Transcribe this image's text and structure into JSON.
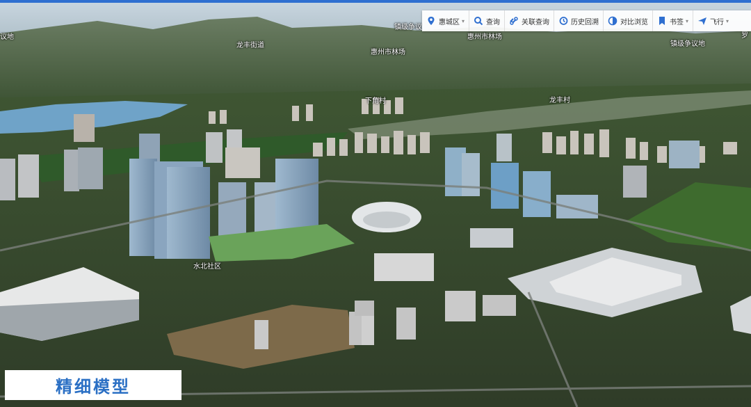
{
  "toolbar": {
    "items": [
      {
        "label": "惠城区",
        "icon": "location-pin-icon",
        "dropdown": true
      },
      {
        "label": "查询",
        "icon": "search-icon",
        "dropdown": false
      },
      {
        "label": "关联查询",
        "icon": "link-search-icon",
        "dropdown": false
      },
      {
        "label": "历史回溯",
        "icon": "history-icon",
        "dropdown": false
      },
      {
        "label": "对比浏览",
        "icon": "compare-icon",
        "dropdown": false
      },
      {
        "label": "书签",
        "icon": "bookmark-icon",
        "dropdown": true
      },
      {
        "label": "飞行",
        "icon": "plane-icon",
        "dropdown": true
      }
    ],
    "accent": "#2f6fd0"
  },
  "map_labels": {
    "l1": "议地",
    "l2": "龙丰街道",
    "l3": "镇级争议",
    "l4": "惠州市林场",
    "l5": "惠州市林场",
    "l6": "镇级争议地",
    "l7": "罗",
    "l8": "下角村",
    "l9": "龙丰村",
    "l10": "水北社区"
  },
  "caption": "精细模型",
  "colors": {
    "caption_text": "#2a6fc4",
    "toolbar_bg": "#ffffff"
  }
}
